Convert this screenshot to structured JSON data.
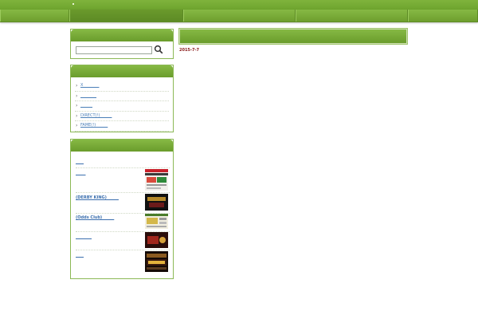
{
  "header": {
    "site_title": ""
  },
  "nav": {
    "tabs": [
      "",
      "",
      "",
      "",
      ""
    ]
  },
  "search": {
    "placeholder": ""
  },
  "categories": {
    "items": [
      {
        "label": "X________"
      },
      {
        "label": "________"
      },
      {
        "label": "______"
      },
      {
        "label": "DIRECT(!)______"
      },
      {
        "label": "FAME(!)______"
      }
    ]
  },
  "links": {
    "items": [
      {
        "label": "____",
        "thumb": ""
      },
      {
        "label": "_____",
        "thumb": "red-site-thumbnail"
      },
      {
        "label": "(DERBY KING)______",
        "thumb": "dark-site-thumbnail"
      },
      {
        "label": "(Odds Club)______",
        "thumb": "light-site-thumbnail"
      },
      {
        "label": "________",
        "thumb": "dark-red-site-thumbnail"
      },
      {
        "label": "____",
        "thumb": "dark-gold-site-thumbnail"
      }
    ]
  },
  "main": {
    "title": "",
    "date": "2015-7-7"
  },
  "colors": {
    "brand_green": "#77ad36",
    "link_blue": "#3b6fae",
    "date_red": "#8a1a1a"
  }
}
